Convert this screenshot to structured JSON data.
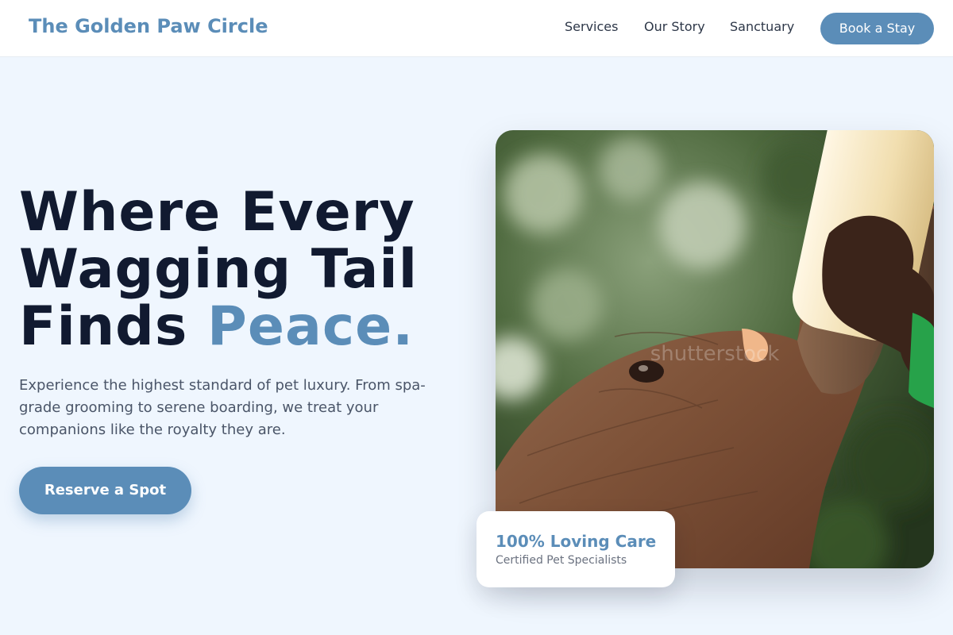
{
  "header": {
    "brand": "The Golden Paw Circle",
    "nav": {
      "services": "Services",
      "our_story": "Our Story",
      "sanctuary": "Sanctuary"
    },
    "cta": "Book a Stay"
  },
  "hero": {
    "headline_line1": "Where Every",
    "headline_line2": "Wagging Tail",
    "headline_line3_prefix": "Finds ",
    "headline_accent": "Peace.",
    "description": "Experience the highest standard of pet luxury. From spa-grade grooming to serene boarding, we treat your companions like the royalty they are.",
    "cta": "Reserve a Spot",
    "image_watermark": "shutterstock"
  },
  "badge": {
    "title": "100% Loving Care",
    "subtitle": "Certified Pet Specialists"
  },
  "colors": {
    "accent": "#5b8db8",
    "background": "#eff6fe",
    "heading": "#111a30"
  },
  "icons": {
    "hero_photo": "elephant-bottle-feeding-photo"
  }
}
